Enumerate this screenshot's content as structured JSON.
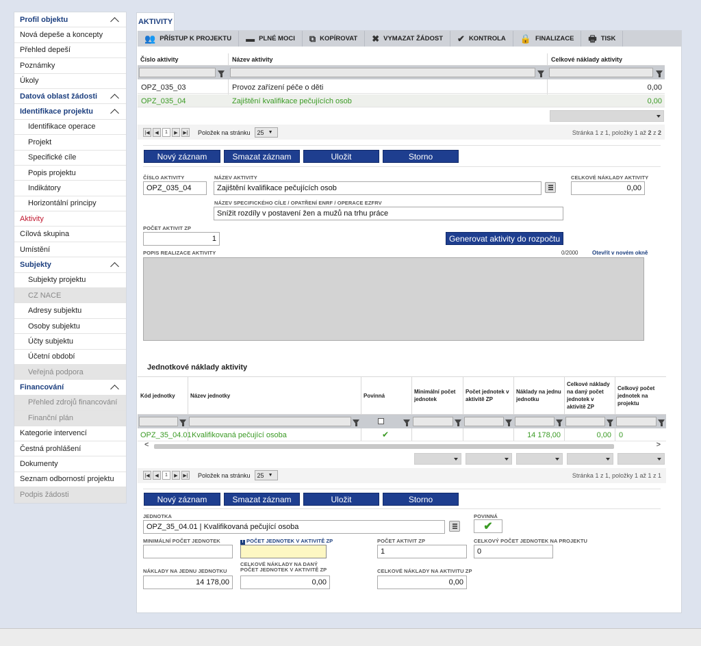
{
  "sidebar": {
    "items": [
      {
        "label": "Profil objektu",
        "type": "hdr"
      },
      {
        "label": "Nová depeše a koncepty",
        "type": "item"
      },
      {
        "label": "Přehled depeší",
        "type": "item"
      },
      {
        "label": "Poznámky",
        "type": "item"
      },
      {
        "label": "Úkoly",
        "type": "item"
      },
      {
        "label": "Datová oblast žádosti",
        "type": "hdr"
      },
      {
        "label": "Identifikace projektu",
        "type": "hdr"
      },
      {
        "label": "Identifikace operace",
        "type": "sub"
      },
      {
        "label": "Projekt",
        "type": "sub"
      },
      {
        "label": "Specifické cíle",
        "type": "sub"
      },
      {
        "label": "Popis projektu",
        "type": "sub"
      },
      {
        "label": "Indikátory",
        "type": "sub"
      },
      {
        "label": "Horizontální principy",
        "type": "sub"
      },
      {
        "label": "Aktivity",
        "type": "active"
      },
      {
        "label": "Cílová skupina",
        "type": "item"
      },
      {
        "label": "Umístění",
        "type": "item"
      },
      {
        "label": "Subjekty",
        "type": "hdr"
      },
      {
        "label": "Subjekty projektu",
        "type": "sub"
      },
      {
        "label": "CZ NACE",
        "type": "subdis"
      },
      {
        "label": "Adresy subjektu",
        "type": "sub"
      },
      {
        "label": "Osoby subjektu",
        "type": "sub"
      },
      {
        "label": "Účty subjektu",
        "type": "sub"
      },
      {
        "label": "Účetní období",
        "type": "sub"
      },
      {
        "label": "Veřejná podpora",
        "type": "subdis"
      },
      {
        "label": "Financování",
        "type": "hdr"
      },
      {
        "label": "Přehled zdrojů financování",
        "type": "subdis"
      },
      {
        "label": "Finanční plán",
        "type": "subdis"
      },
      {
        "label": "Kategorie intervencí",
        "type": "item"
      },
      {
        "label": "Čestná prohlášení",
        "type": "item"
      },
      {
        "label": "Dokumenty",
        "type": "item"
      },
      {
        "label": "Seznam odborností projektu",
        "type": "item"
      },
      {
        "label": "Podpis žádosti",
        "type": "dis"
      }
    ]
  },
  "tab": {
    "label": "AKTIVITY"
  },
  "toolbar": [
    {
      "label": "PŘÍSTUP K PROJEKTU",
      "icon": "people-icon",
      "glyph": "👥"
    },
    {
      "label": "PLNÉ MOCI",
      "icon": "card-icon",
      "glyph": "▬"
    },
    {
      "label": "KOPÍROVAT",
      "icon": "copy-icon",
      "glyph": "⧉"
    },
    {
      "label": "VYMAZAT ŽÁDOST",
      "icon": "x-icon",
      "glyph": "✖"
    },
    {
      "label": "KONTROLA",
      "icon": "check-icon",
      "glyph": "✔"
    },
    {
      "label": "FINALIZACE",
      "icon": "lock-icon",
      "glyph": "🔒"
    },
    {
      "label": "TISK",
      "icon": "printer-icon",
      "glyph": "🖶"
    }
  ],
  "grid1": {
    "headers": [
      "Číslo aktivity",
      "Název aktivity",
      "Celkové náklady aktivity"
    ],
    "rows": [
      {
        "cislo": "OPZ_035_03",
        "nazev": "Provoz zařízení péče o děti",
        "naklady": "0,00"
      },
      {
        "cislo": "OPZ_035_04",
        "nazev": "Zajištění kvalifikace pečujících osob",
        "naklady": "0,00"
      }
    ],
    "pager": {
      "page": "1",
      "per_page_label": "Položek na stránku",
      "per_page": "25",
      "status_pre": "Stránka 1 z 1, položky 1 až ",
      "status_bold": "2",
      "status_mid": " z ",
      "status_bold2": "2"
    }
  },
  "buttons": {
    "new": "Nový záznam",
    "delete": "Smazat záznam",
    "save": "Uložit",
    "cancel": "Storno",
    "generate": "Generovat aktivity do rozpočtu"
  },
  "form1": {
    "cislo_label": "ČÍSLO AKTIVITY",
    "cislo": "OPZ_035_04",
    "nazev_label": "NÁZEV AKTIVITY",
    "nazev": "Zajištění kvalifikace pečujících osob",
    "naklady_label": "CELKOVÉ NÁKLADY AKTIVITY",
    "naklady": "0,00",
    "cil_label": "NÁZEV SPECIFICKÉHO CÍLE / OPATŘENÍ ENRF / OPERACE EZFRV",
    "cil": "Snížit rozdíly v postavení žen a mužů na trhu práce",
    "pocet_label": "POČET AKTIVIT ZP",
    "pocet": "1",
    "popis_label": "POPIS REALIZACE AKTIVITY",
    "counter": "0/2000",
    "open_link": "Otevřít v novém okně"
  },
  "grid2": {
    "title": "Jednotkové náklady aktivity",
    "headers": [
      "Kód jednotky",
      "Název jednotky",
      "Povinná",
      "Minimální počet jednotek",
      "Počet jednotek v aktivitě ZP",
      "Náklady na jednu jednotku",
      "Celkové náklady na daný počet jednotek v aktivitě ZP",
      "Celkový počet jednotek na projektu"
    ],
    "row": {
      "kod": "OPZ_35_04.01",
      "nazev": "Kvalifikovaná pečující osoba",
      "povinna": "✔",
      "min": "",
      "pocet": "",
      "naklady": "14 178,00",
      "celkem": "0,00",
      "celkpocet": "0"
    },
    "pager": {
      "page": "1",
      "per_page_label": "Položek na stránku",
      "per_page": "25",
      "status": "Stránka 1 z 1, položky 1 až 1 z 1"
    }
  },
  "form2": {
    "jednotka_label": "JEDNOTKA",
    "jednotka": "OPZ_35_04.01 | Kvalifikovaná pečující osoba",
    "povinna_label": "POVINNÁ",
    "povinna": "✔",
    "min_label": "MINIMÁLNÍ POČET JEDNOTEK",
    "min": "",
    "pocet_label": "POČET JEDNOTEK V AKTIVITĚ ZP",
    "pocet": "",
    "aktivit_label": "POČET AKTIVIT ZP",
    "aktivit": "1",
    "celkpocet_label": "CELKOVÝ POČET JEDNOTEK NA PROJEKTU",
    "celkpocet": "0",
    "naklady_label": "NÁKLADY NA JEDNU JEDNOTKU",
    "naklady": "14 178,00",
    "celkdany_label1": "CELKOVÉ NÁKLADY NA DANÝ",
    "celkdany_label2": "POČET JEDNOTEK V AKTIVITĚ ZP",
    "celkdany": "0,00",
    "celkakt_label": "CELKOVÉ NÁKLADY NA AKTIVITU ZP",
    "celkakt": "0,00"
  },
  "colors": {
    "accent": "#1e3e8f",
    "green": "#3a9a24",
    "red": "#c0162e"
  }
}
